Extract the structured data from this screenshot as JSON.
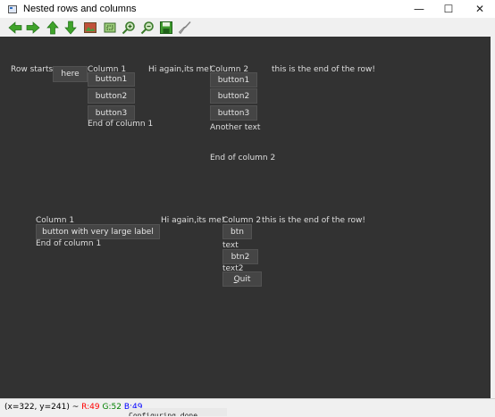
{
  "window": {
    "title": "Nested rows and columns",
    "minimize_glyph": "—",
    "maximize_glyph": "☐",
    "close_glyph": "✕"
  },
  "toolbar": {
    "icons": [
      "back-arrow-icon",
      "forward-arrow-icon",
      "up-arrow-icon",
      "down-arrow-icon",
      "image-icon",
      "select-icon",
      "zoom-in-icon",
      "zoom-out-icon",
      "save-icon",
      "clean-icon"
    ]
  },
  "row1": {
    "row_starts": "Row starts",
    "here": "here",
    "col1_title": "Column 1",
    "col1_buttons": [
      "button1",
      "button2",
      "button3"
    ],
    "col1_end": "End of column 1",
    "hi_again": "Hi again,its me!",
    "col2_title": "Column 2",
    "col2_buttons": [
      "button1",
      "button2",
      "button3"
    ],
    "another_text": "Another text",
    "col2_end": "End of column 2",
    "row_end": "this is the end of the row!"
  },
  "row2": {
    "col1_title": "Column 1",
    "big_button": "button with very large label",
    "col1_end": "End of column 1",
    "hi_again": "Hi again,its me!",
    "col2_title": "Column 2",
    "row_end": "this is the end of the row!",
    "btn": "btn",
    "text": "text",
    "btn2": "btn2",
    "text2": "text2",
    "quit_first": "Q",
    "quit_rest": "uit"
  },
  "status": {
    "coords": "(x=322, y=241) ~",
    "r": "R:49",
    "g": "G:52",
    "b": "B:49",
    "r_color": "#ff0000",
    "g_color": "#008000",
    "b_color": "#0000ff",
    "terminal_text": "Configuring done"
  }
}
